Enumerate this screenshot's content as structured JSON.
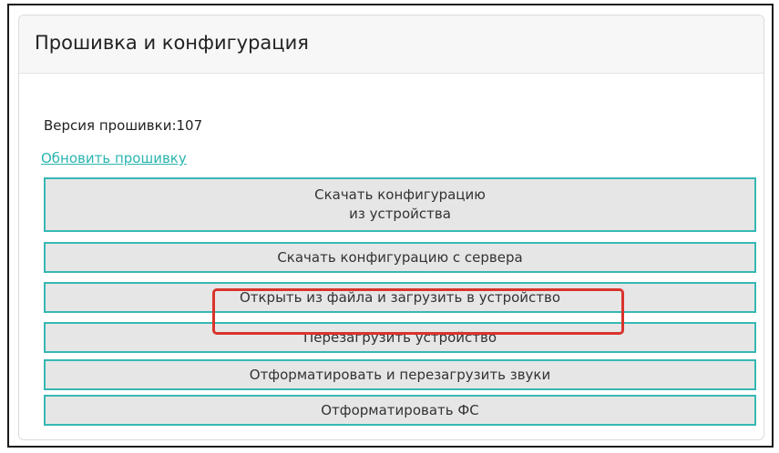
{
  "panel": {
    "title": "Прошивка и конфигурация"
  },
  "firmware": {
    "version_text": "Версия прошивки:107",
    "update_link": "Обновить прошивку"
  },
  "buttons": {
    "download_from_device_line1": "Скачать конфигурацию",
    "download_from_device_line2": "из устройства",
    "download_from_server": "Скачать конфигурацию с сервера",
    "open_from_file": "Открыть из файла и загрузить в устройство",
    "reboot_device": "Перезагрузить устройство",
    "format_and_reboot_sounds": "Отформатировать и перезагрузить звуки",
    "format_fs": "Отформатировать ФС"
  },
  "colors": {
    "button_border": "#36b8b3",
    "link": "#2bb5b0",
    "highlight": "#d9342b"
  }
}
